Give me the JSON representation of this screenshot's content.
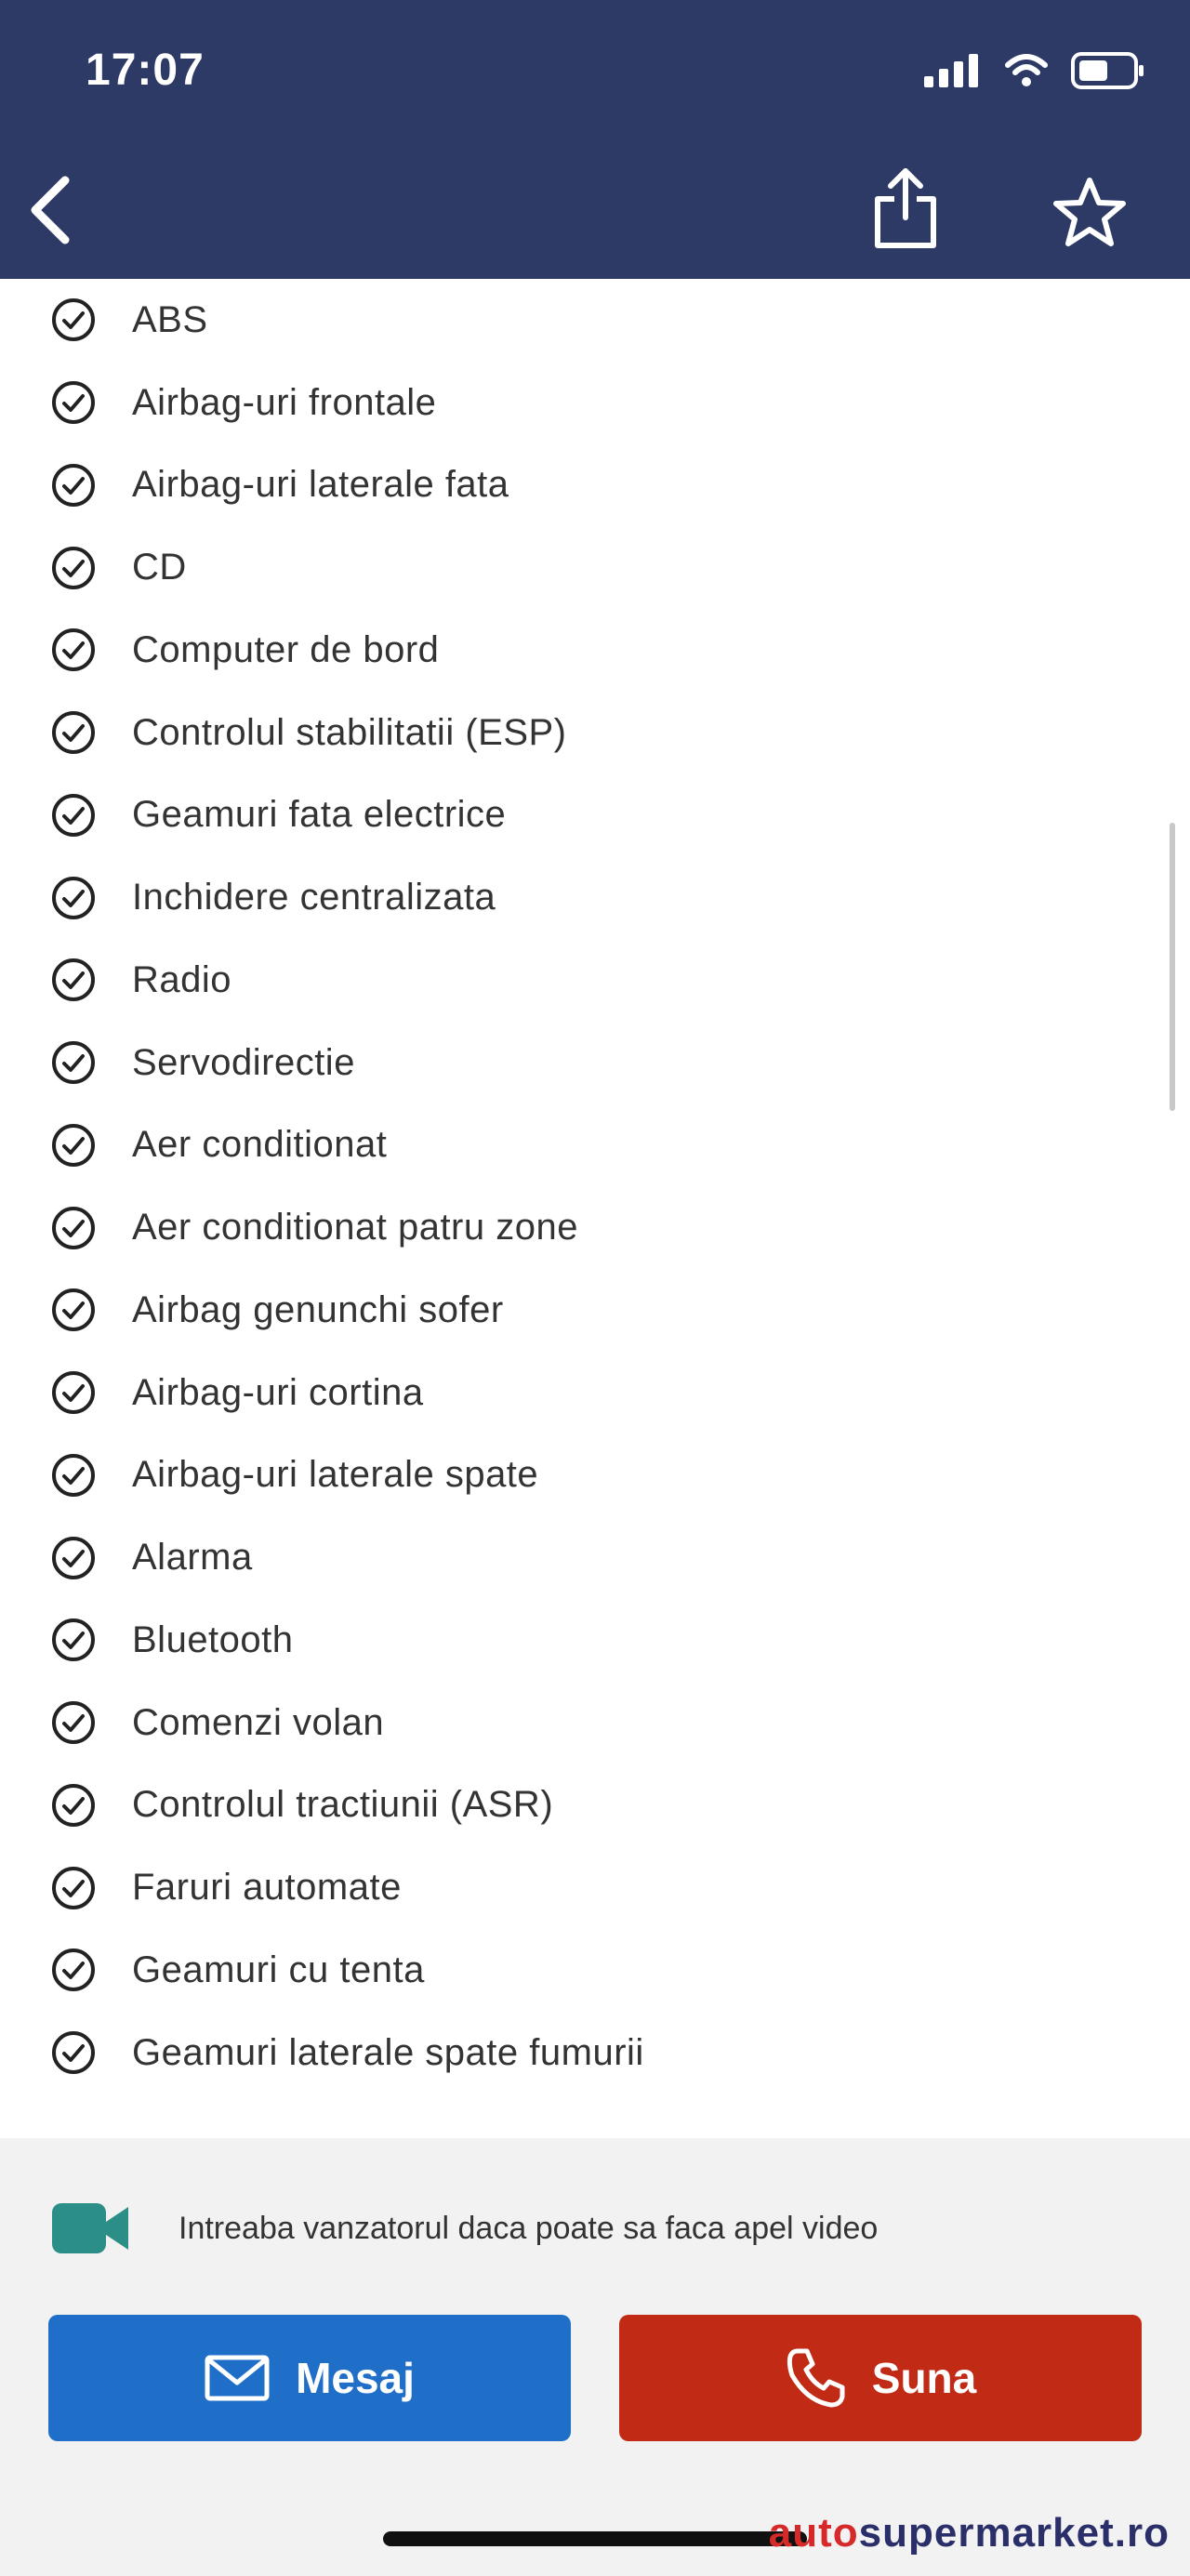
{
  "status_bar": {
    "time": "17:07"
  },
  "features": [
    "ABS",
    "Airbag-uri frontale",
    "Airbag-uri laterale fata",
    "CD",
    "Computer de bord",
    "Controlul stabilitatii (ESP)",
    "Geamuri fata electrice",
    "Inchidere centralizata",
    "Radio",
    "Servodirectie",
    "Aer conditionat",
    "Aer conditionat patru zone",
    "Airbag genunchi sofer",
    "Airbag-uri cortina",
    "Airbag-uri laterale spate",
    "Alarma",
    "Bluetooth",
    "Comenzi volan",
    "Controlul tractiunii (ASR)",
    "Faruri automate",
    "Geamuri cu tenta",
    "Geamuri laterale spate fumurii"
  ],
  "video_call": {
    "text": "Intreaba vanzatorul daca poate sa faca apel video"
  },
  "actions": {
    "message_label": "Mesaj",
    "call_label": "Suna"
  },
  "watermark": {
    "part1": "auto",
    "part2": "supermarket.ro"
  },
  "colors": {
    "header_bg": "#2d3a66",
    "message_button": "#1f6fc9",
    "call_button": "#c12a14",
    "video_icon": "#2b8f87"
  },
  "icons": [
    "back-chevron-icon",
    "share-icon",
    "star-icon",
    "check-circle-icon",
    "video-camera-icon",
    "mail-icon",
    "phone-icon"
  ]
}
